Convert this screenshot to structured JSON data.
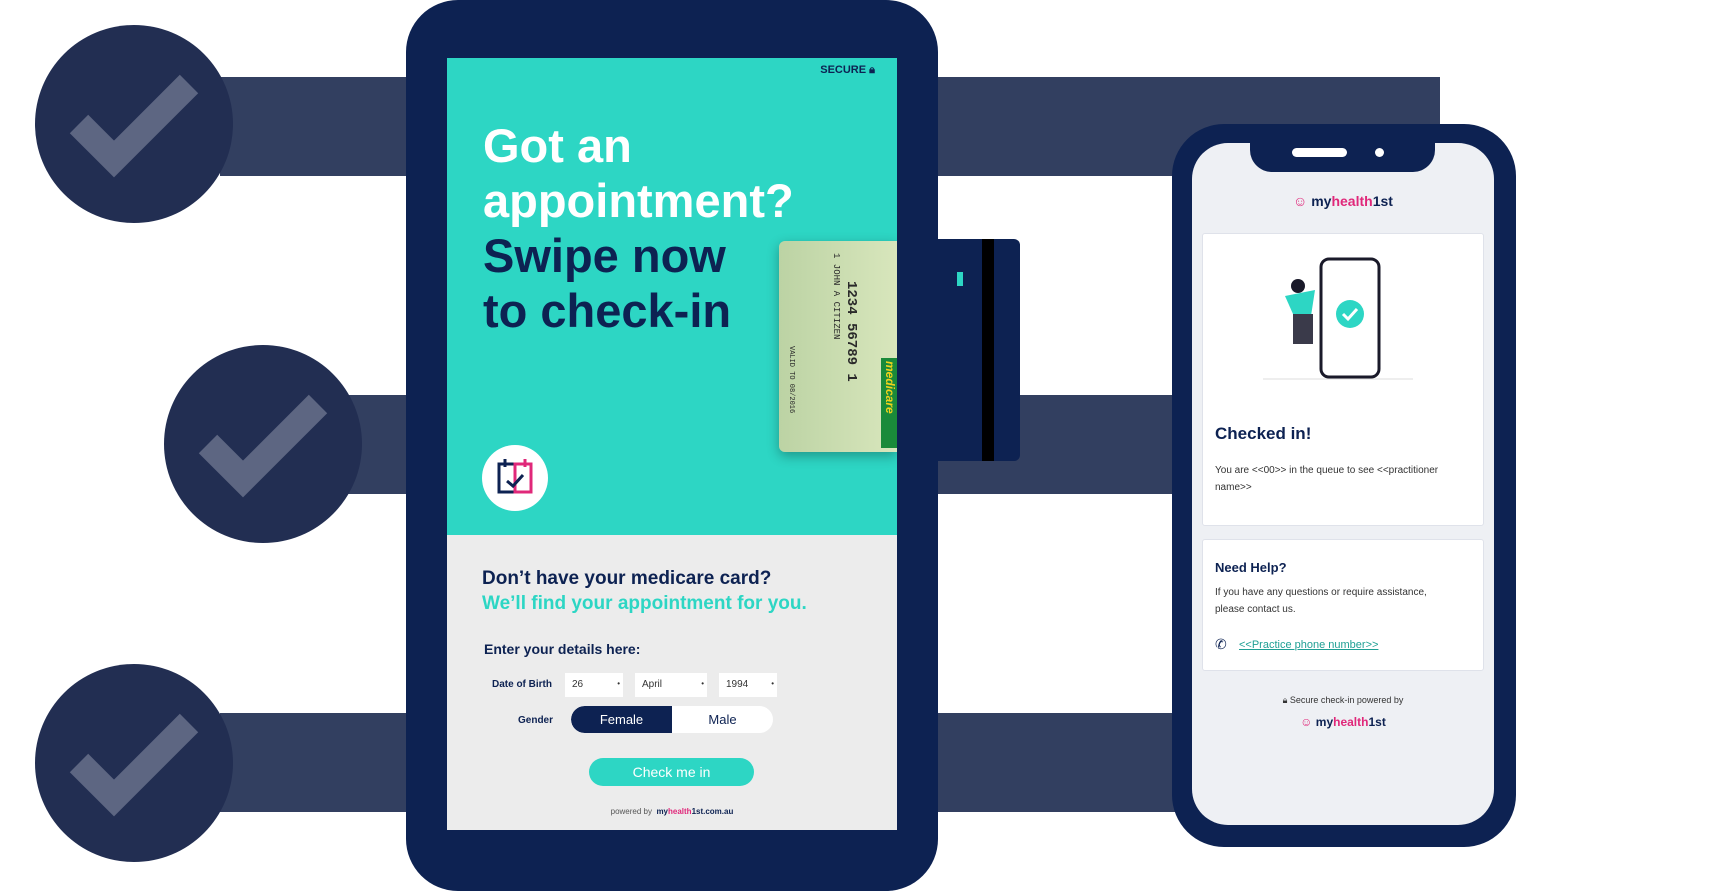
{
  "colors": {
    "navy": "#0d2252",
    "teal": "#2dd6c4",
    "pink": "#e0287a",
    "bar": "#323f60",
    "circle": "#222e52"
  },
  "decor": {
    "check_icons": [
      "check-icon",
      "check-icon",
      "check-icon"
    ]
  },
  "tablet": {
    "secure_label": "SECURE",
    "headline_white": [
      "Got an",
      "appointment?"
    ],
    "headline_navy": [
      "Swipe now",
      "to check-in"
    ],
    "medicare_card": {
      "number": "1234 56789 1",
      "name": "1 JOHN A CITIZEN",
      "valid": "VALID TO 08/2016",
      "brand": "medicare"
    },
    "question": "Don’t have your medicare card?",
    "subtitle": "We’ll find your appointment for you.",
    "enter_details": "Enter your details here:",
    "dob_label": "Date of Birth",
    "dob": {
      "day": "26",
      "month": "April",
      "year": "1994"
    },
    "gender_label": "Gender",
    "gender_options": [
      "Female",
      "Male"
    ],
    "gender_selected": "Female",
    "check_in_button": "Check me in",
    "powered_by": "powered by",
    "powered_logo": {
      "a": "my",
      "b": "health",
      "c": "1st.com.au"
    }
  },
  "phone": {
    "logo": {
      "a": "my",
      "b": "health",
      "c": "1st"
    },
    "checked_title": "Checked in!",
    "queue_text": "You are <<00>> in the queue to see <<practitioner name>>",
    "help_title": "Need Help?",
    "help_text": "If you have any questions or require assistance, please contact us.",
    "phone_link": "<<Practice phone number>>",
    "secure_text": "Secure check-in powered by"
  }
}
